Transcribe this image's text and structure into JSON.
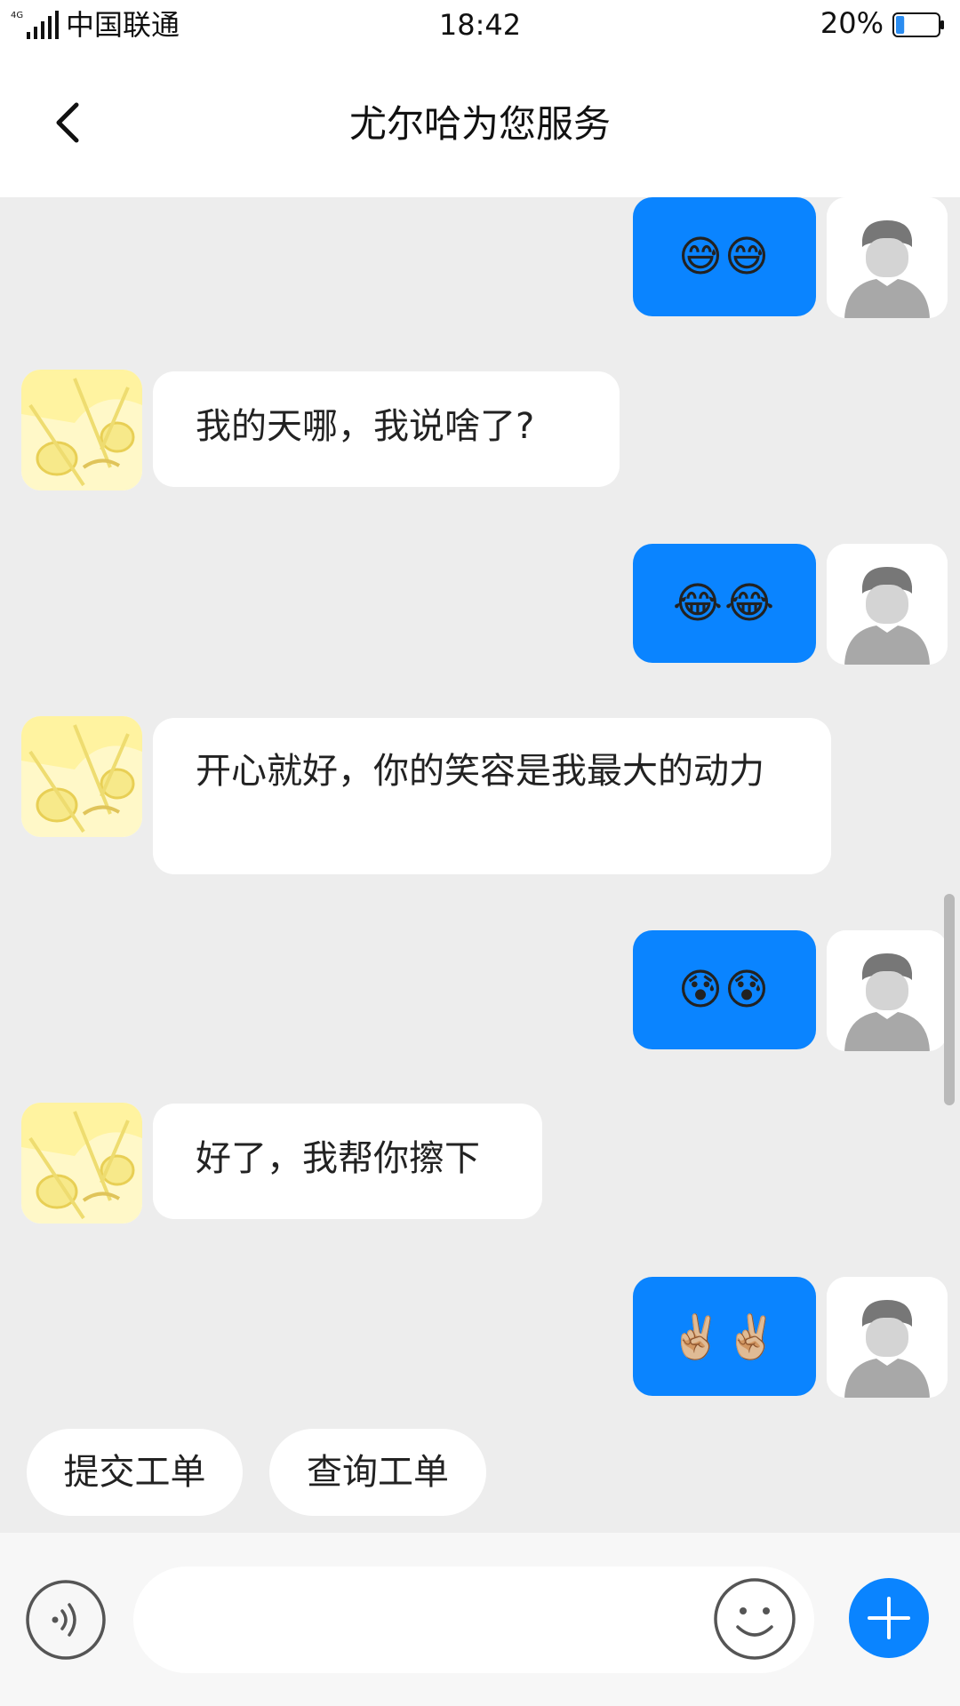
{
  "status_bar": {
    "network": "4G",
    "carrier": "中国联通",
    "time": "18:42",
    "battery_percent": "20%",
    "battery_level": 0.2
  },
  "header": {
    "title": "尤尔哈为您服务",
    "back_icon": "chevron-left-icon"
  },
  "messages": [
    {
      "sender": "user",
      "text": "😅😅"
    },
    {
      "sender": "bot",
      "text": "我的天哪，我说啥了?"
    },
    {
      "sender": "user",
      "text": "😂😂"
    },
    {
      "sender": "bot",
      "text": "开心就好，你的笑容是我最大的动力"
    },
    {
      "sender": "user",
      "text": "😰😰"
    },
    {
      "sender": "bot",
      "text": "好了，我帮你擦下"
    },
    {
      "sender": "user",
      "text": "✌🏼✌🏼"
    }
  ],
  "quick_actions": [
    {
      "label": "提交工单"
    },
    {
      "label": "查询工单"
    }
  ],
  "input_bar": {
    "text_value": "",
    "voice_icon": "voice-icon",
    "emoji_icon": "emoji-icon",
    "plus_icon": "plus-icon"
  },
  "colors": {
    "accent": "#0a84ff",
    "background": "#ededed",
    "bubble_bot": "#ffffff"
  }
}
